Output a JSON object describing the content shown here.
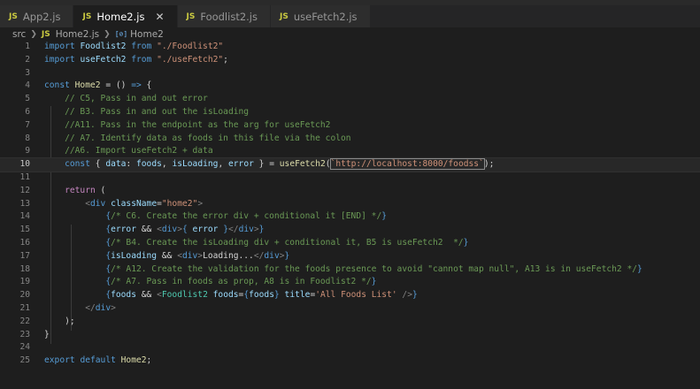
{
  "tabs": [
    {
      "label": "App2.js",
      "badge": "JS",
      "active": false
    },
    {
      "label": "Home2.js",
      "badge": "JS",
      "active": true
    },
    {
      "label": "Foodlist2.js",
      "badge": "JS",
      "active": false
    },
    {
      "label": "useFetch2.js",
      "badge": "JS",
      "active": false
    }
  ],
  "breadcrumb": {
    "folder": "src",
    "file": "Home2.js",
    "file_badge": "JS",
    "symbol": "Home2",
    "symbol_badge": "[⊘]"
  },
  "editor": {
    "current_line": 10,
    "lines": [
      {
        "n": "1",
        "tokens": [
          [
            "k",
            "import "
          ],
          [
            "v",
            "Foodlist2"
          ],
          [
            "k",
            " from "
          ],
          [
            "s",
            "\"./Foodlist2\""
          ]
        ]
      },
      {
        "n": "2",
        "tokens": [
          [
            "k",
            "import "
          ],
          [
            "v",
            "useFetch2"
          ],
          [
            "k",
            " from "
          ],
          [
            "s",
            "\"./useFetch2\""
          ],
          [
            "code",
            ";"
          ]
        ]
      },
      {
        "n": "3",
        "tokens": []
      },
      {
        "n": "4",
        "tokens": [
          [
            "k",
            "const "
          ],
          [
            "f",
            "Home2"
          ],
          [
            "code",
            " = () "
          ],
          [
            "k",
            "=>"
          ],
          [
            "code",
            " {"
          ]
        ]
      },
      {
        "n": "5",
        "tokens": [
          [
            "code",
            "    "
          ],
          [
            "c",
            "// C5, Pass in and out error"
          ]
        ]
      },
      {
        "n": "6",
        "tokens": [
          [
            "code",
            "    "
          ],
          [
            "c",
            "// B3. Pass in and out the isLoading"
          ]
        ]
      },
      {
        "n": "7",
        "tokens": [
          [
            "code",
            "    "
          ],
          [
            "c",
            "//A11. Pass in the endpoint as the arg for useFetch2"
          ]
        ]
      },
      {
        "n": "8",
        "tokens": [
          [
            "code",
            "    "
          ],
          [
            "c",
            "// A7. Identify data as foods in this file via the colon"
          ]
        ]
      },
      {
        "n": "9",
        "tokens": [
          [
            "code",
            "    "
          ],
          [
            "c",
            "//A6. Import useFetch2 + data"
          ]
        ]
      },
      {
        "n": "10",
        "tokens": [
          [
            "code",
            "    "
          ],
          [
            "k",
            "const "
          ],
          [
            "code",
            "{ "
          ],
          [
            "v",
            "data"
          ],
          [
            "code",
            ": "
          ],
          [
            "v",
            "foods"
          ],
          [
            "code",
            ", "
          ],
          [
            "v",
            "isLoading"
          ],
          [
            "code",
            ", "
          ],
          [
            "v",
            "error"
          ],
          [
            "code",
            " } = "
          ],
          [
            "f",
            "useFetch2"
          ],
          [
            "code",
            "("
          ],
          [
            "sbox",
            "`http://localhost:8000/foodss`"
          ],
          [
            "code",
            ");"
          ]
        ]
      },
      {
        "n": "11",
        "tokens": []
      },
      {
        "n": "12",
        "tokens": [
          [
            "code",
            "    "
          ],
          [
            "kw2",
            "return"
          ],
          [
            "code",
            " ("
          ]
        ]
      },
      {
        "n": "13",
        "tokens": [
          [
            "code",
            "        "
          ],
          [
            "p",
            "<"
          ],
          [
            "k",
            "div "
          ],
          [
            "v",
            "className"
          ],
          [
            "code",
            "="
          ],
          [
            "s",
            "\"home2\""
          ],
          [
            "p",
            ">"
          ]
        ]
      },
      {
        "n": "14",
        "tokens": [
          [
            "code",
            "            "
          ],
          [
            "k",
            "{"
          ],
          [
            "c",
            "/* C6. Create the error div + conditional it [END] */"
          ],
          [
            "k",
            "}"
          ]
        ]
      },
      {
        "n": "15",
        "tokens": [
          [
            "code",
            "            "
          ],
          [
            "k",
            "{"
          ],
          [
            "v",
            "error"
          ],
          [
            "code",
            " && "
          ],
          [
            "p",
            "<"
          ],
          [
            "k",
            "div"
          ],
          [
            "p",
            ">"
          ],
          [
            "k",
            "{ "
          ],
          [
            "v",
            "error"
          ],
          [
            "k",
            " }"
          ],
          [
            "p",
            "</"
          ],
          [
            "k",
            "div"
          ],
          [
            "p",
            ">"
          ],
          [
            "k",
            "}"
          ]
        ]
      },
      {
        "n": "16",
        "tokens": [
          [
            "code",
            "            "
          ],
          [
            "k",
            "{"
          ],
          [
            "c",
            "/* B4. Create the isLoading div + conditional it, B5 is useFetch2  */"
          ],
          [
            "k",
            "}"
          ]
        ]
      },
      {
        "n": "17",
        "tokens": [
          [
            "code",
            "            "
          ],
          [
            "k",
            "{"
          ],
          [
            "v",
            "isLoading"
          ],
          [
            "code",
            " && "
          ],
          [
            "p",
            "<"
          ],
          [
            "k",
            "div"
          ],
          [
            "p",
            ">"
          ],
          [
            "code",
            "Loading..."
          ],
          [
            "p",
            "</"
          ],
          [
            "k",
            "div"
          ],
          [
            "p",
            ">"
          ],
          [
            "k",
            "}"
          ]
        ]
      },
      {
        "n": "18",
        "tokens": [
          [
            "code",
            "            "
          ],
          [
            "k",
            "{"
          ],
          [
            "c",
            "/* A12. Create the validation for the foods presence to avoid \"cannot map null\", A13 is in useFetch2 */"
          ],
          [
            "k",
            "}"
          ]
        ]
      },
      {
        "n": "19",
        "tokens": [
          [
            "code",
            "            "
          ],
          [
            "k",
            "{"
          ],
          [
            "c",
            "/* A7. Pass in foods as prop, A8 is in Foodlist2 */"
          ],
          [
            "k",
            "}"
          ]
        ]
      },
      {
        "n": "20",
        "tokens": [
          [
            "code",
            "            "
          ],
          [
            "k",
            "{"
          ],
          [
            "v",
            "foods"
          ],
          [
            "code",
            " && "
          ],
          [
            "p",
            "<"
          ],
          [
            "t",
            "Foodlist2 "
          ],
          [
            "v",
            "foods"
          ],
          [
            "code",
            "="
          ],
          [
            "k",
            "{"
          ],
          [
            "v",
            "foods"
          ],
          [
            "k",
            "}"
          ],
          [
            "code",
            " "
          ],
          [
            "v",
            "title"
          ],
          [
            "code",
            "="
          ],
          [
            "s",
            "'All Foods List'"
          ],
          [
            "code",
            " "
          ],
          [
            "p",
            "/>"
          ],
          [
            "k",
            "}"
          ]
        ]
      },
      {
        "n": "21",
        "tokens": [
          [
            "code",
            "        "
          ],
          [
            "p",
            "</"
          ],
          [
            "k",
            "div"
          ],
          [
            "p",
            ">"
          ]
        ]
      },
      {
        "n": "22",
        "tokens": [
          [
            "code",
            "    );"
          ]
        ]
      },
      {
        "n": "23",
        "tokens": [
          [
            "code",
            "}"
          ]
        ]
      },
      {
        "n": "24",
        "tokens": []
      },
      {
        "n": "25",
        "tokens": [
          [
            "k",
            "export "
          ],
          [
            "k",
            "default "
          ],
          [
            "f",
            "Home2"
          ],
          [
            "code",
            ";"
          ]
        ]
      }
    ]
  }
}
